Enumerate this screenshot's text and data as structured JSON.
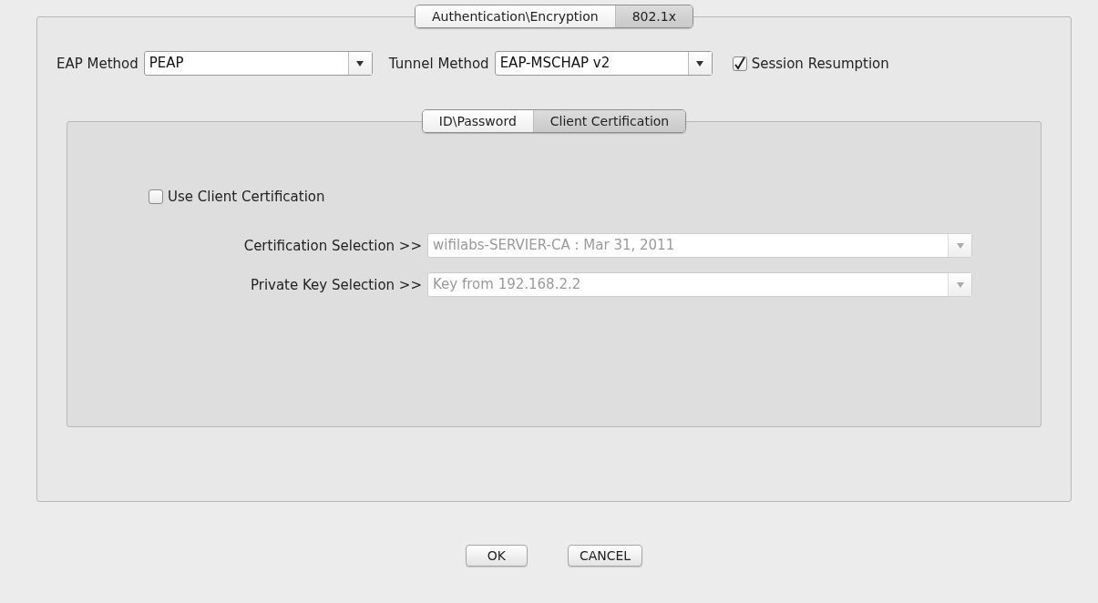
{
  "tabs": [
    {
      "label": "Authentication\\Encryption",
      "selected": false
    },
    {
      "label": "802.1x",
      "selected": true
    }
  ],
  "eap_method": {
    "label": "EAP Method",
    "value": "PEAP"
  },
  "tunnel_method": {
    "label": "Tunnel Method",
    "value": "EAP-MSCHAP v2"
  },
  "session_resumption": {
    "label": "Session Resumption",
    "checked": true
  },
  "inner_tabs": [
    {
      "label": "ID\\Password",
      "selected": false
    },
    {
      "label": "Client Certification",
      "selected": true
    }
  ],
  "use_client_certification": {
    "label": "Use Client Certification",
    "checked": false
  },
  "selections": [
    {
      "label": "Certification Selection >>",
      "value": "wifilabs-SERVIER-CA : Mar 31, 2011",
      "disabled": true
    },
    {
      "label": "Private Key Selection >>",
      "value": "Key from 192.168.2.2",
      "disabled": true
    }
  ],
  "buttons": [
    "OK",
    "CANCEL"
  ]
}
